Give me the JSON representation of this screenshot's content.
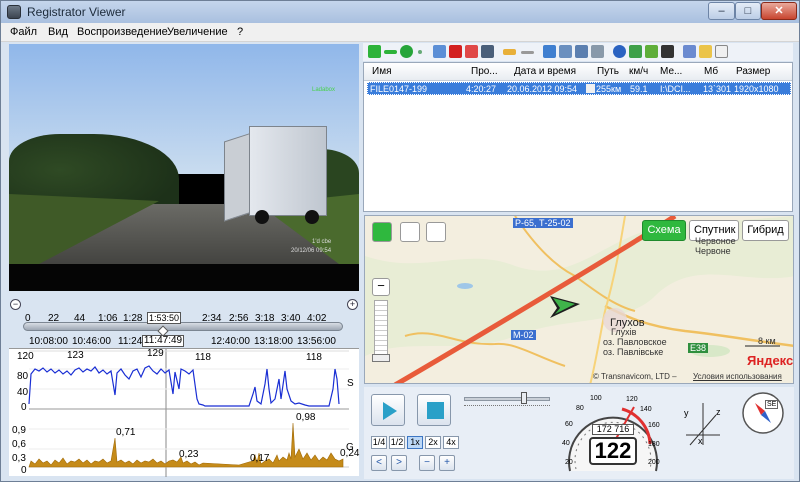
{
  "window": {
    "title": "Registrator Viewer",
    "min": "–",
    "max": "□",
    "close": "✕"
  },
  "menu": [
    "Файл",
    "Вид",
    "Воспроизведение",
    "Увеличение",
    "?"
  ],
  "video": {
    "osd_brand": "Ladabox",
    "osd_line1": "1'd cbe",
    "osd_line2": "20/12/06 09:54"
  },
  "timeline": {
    "ticks": [
      "0",
      "22",
      "44",
      "1:06",
      "1:28",
      "1:53:50",
      "2:34",
      "2:56",
      "3:18",
      "3:40",
      "4:02"
    ],
    "current": "1:53:50",
    "times": [
      "10:08:00",
      "10:46:00",
      "11:24:00",
      "11:47:49",
      "12:40:00",
      "13:18:00",
      "13:56:00"
    ],
    "current_time": "11:47:49"
  },
  "speed_graph": {
    "labels": [
      "120",
      "80",
      "40",
      "0"
    ],
    "peaks": [
      "123",
      "129",
      "118",
      "118"
    ],
    "axis": "S"
  },
  "g_graph": {
    "labels": [
      "0,9",
      "0,6",
      "0,3",
      "0"
    ],
    "peaks": [
      "0,71",
      "0,23",
      "0,17",
      "0,98",
      "0,24"
    ],
    "axis": "G"
  },
  "list": {
    "columns": [
      "Имя",
      "Про...",
      "Дата и время",
      "Путь",
      "км/ч",
      "Ме...",
      "Мб",
      "Размер"
    ],
    "rows": [
      {
        "name": "FILE0147-199",
        "duration": "4:20:27",
        "datetime": "20.06.2012 09:54",
        "path": "255км",
        "speed": "59.1",
        "path_full": "I:\\DCI...",
        "mb": "13`301",
        "size": "1920x1080"
      }
    ]
  },
  "map": {
    "buttons": [
      "Схема",
      "Спутник",
      "Гибрид"
    ],
    "active_button": "Схема",
    "labels": {
      "road1": "Р-65, Т-25-02",
      "city": "Глухов",
      "city2": "Глухів",
      "place1": "Червоное",
      "place2": "Червоне",
      "place3": "оз. Павловское",
      "place4": "оз. Павлівське",
      "road2": "М-02",
      "road3": "Е38",
      "scale": "8 км",
      "brand": "Яндекс",
      "copyright": "© Transnavicom, LTD –",
      "terms": "Условия использования"
    }
  },
  "controls": {
    "speeds": [
      "1/4",
      "1/2",
      "1x",
      "2x",
      "4x"
    ],
    "active_speed": "1x",
    "odometer": "172 716",
    "speed": "122",
    "gauge_labels": [
      "20",
      "40",
      "60",
      "80",
      "100",
      "120",
      "140",
      "160",
      "180",
      "200"
    ],
    "compass": "SE",
    "axes": {
      "x": "x",
      "y": "y",
      "z": "z"
    }
  }
}
